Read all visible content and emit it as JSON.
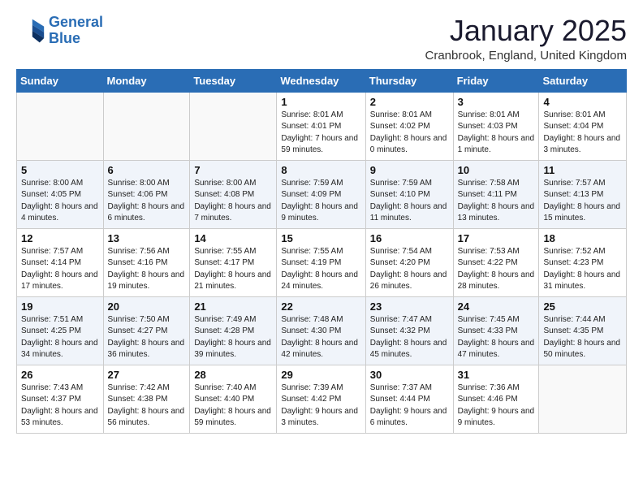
{
  "header": {
    "logo_line1": "General",
    "logo_line2": "Blue",
    "month_title": "January 2025",
    "location": "Cranbrook, England, United Kingdom"
  },
  "weekdays": [
    "Sunday",
    "Monday",
    "Tuesday",
    "Wednesday",
    "Thursday",
    "Friday",
    "Saturday"
  ],
  "weeks": [
    [
      {
        "day": "",
        "info": ""
      },
      {
        "day": "",
        "info": ""
      },
      {
        "day": "",
        "info": ""
      },
      {
        "day": "1",
        "info": "Sunrise: 8:01 AM\nSunset: 4:01 PM\nDaylight: 7 hours and 59 minutes."
      },
      {
        "day": "2",
        "info": "Sunrise: 8:01 AM\nSunset: 4:02 PM\nDaylight: 8 hours and 0 minutes."
      },
      {
        "day": "3",
        "info": "Sunrise: 8:01 AM\nSunset: 4:03 PM\nDaylight: 8 hours and 1 minute."
      },
      {
        "day": "4",
        "info": "Sunrise: 8:01 AM\nSunset: 4:04 PM\nDaylight: 8 hours and 3 minutes."
      }
    ],
    [
      {
        "day": "5",
        "info": "Sunrise: 8:00 AM\nSunset: 4:05 PM\nDaylight: 8 hours and 4 minutes."
      },
      {
        "day": "6",
        "info": "Sunrise: 8:00 AM\nSunset: 4:06 PM\nDaylight: 8 hours and 6 minutes."
      },
      {
        "day": "7",
        "info": "Sunrise: 8:00 AM\nSunset: 4:08 PM\nDaylight: 8 hours and 7 minutes."
      },
      {
        "day": "8",
        "info": "Sunrise: 7:59 AM\nSunset: 4:09 PM\nDaylight: 8 hours and 9 minutes."
      },
      {
        "day": "9",
        "info": "Sunrise: 7:59 AM\nSunset: 4:10 PM\nDaylight: 8 hours and 11 minutes."
      },
      {
        "day": "10",
        "info": "Sunrise: 7:58 AM\nSunset: 4:11 PM\nDaylight: 8 hours and 13 minutes."
      },
      {
        "day": "11",
        "info": "Sunrise: 7:57 AM\nSunset: 4:13 PM\nDaylight: 8 hours and 15 minutes."
      }
    ],
    [
      {
        "day": "12",
        "info": "Sunrise: 7:57 AM\nSunset: 4:14 PM\nDaylight: 8 hours and 17 minutes."
      },
      {
        "day": "13",
        "info": "Sunrise: 7:56 AM\nSunset: 4:16 PM\nDaylight: 8 hours and 19 minutes."
      },
      {
        "day": "14",
        "info": "Sunrise: 7:55 AM\nSunset: 4:17 PM\nDaylight: 8 hours and 21 minutes."
      },
      {
        "day": "15",
        "info": "Sunrise: 7:55 AM\nSunset: 4:19 PM\nDaylight: 8 hours and 24 minutes."
      },
      {
        "day": "16",
        "info": "Sunrise: 7:54 AM\nSunset: 4:20 PM\nDaylight: 8 hours and 26 minutes."
      },
      {
        "day": "17",
        "info": "Sunrise: 7:53 AM\nSunset: 4:22 PM\nDaylight: 8 hours and 28 minutes."
      },
      {
        "day": "18",
        "info": "Sunrise: 7:52 AM\nSunset: 4:23 PM\nDaylight: 8 hours and 31 minutes."
      }
    ],
    [
      {
        "day": "19",
        "info": "Sunrise: 7:51 AM\nSunset: 4:25 PM\nDaylight: 8 hours and 34 minutes."
      },
      {
        "day": "20",
        "info": "Sunrise: 7:50 AM\nSunset: 4:27 PM\nDaylight: 8 hours and 36 minutes."
      },
      {
        "day": "21",
        "info": "Sunrise: 7:49 AM\nSunset: 4:28 PM\nDaylight: 8 hours and 39 minutes."
      },
      {
        "day": "22",
        "info": "Sunrise: 7:48 AM\nSunset: 4:30 PM\nDaylight: 8 hours and 42 minutes."
      },
      {
        "day": "23",
        "info": "Sunrise: 7:47 AM\nSunset: 4:32 PM\nDaylight: 8 hours and 45 minutes."
      },
      {
        "day": "24",
        "info": "Sunrise: 7:45 AM\nSunset: 4:33 PM\nDaylight: 8 hours and 47 minutes."
      },
      {
        "day": "25",
        "info": "Sunrise: 7:44 AM\nSunset: 4:35 PM\nDaylight: 8 hours and 50 minutes."
      }
    ],
    [
      {
        "day": "26",
        "info": "Sunrise: 7:43 AM\nSunset: 4:37 PM\nDaylight: 8 hours and 53 minutes."
      },
      {
        "day": "27",
        "info": "Sunrise: 7:42 AM\nSunset: 4:38 PM\nDaylight: 8 hours and 56 minutes."
      },
      {
        "day": "28",
        "info": "Sunrise: 7:40 AM\nSunset: 4:40 PM\nDaylight: 8 hours and 59 minutes."
      },
      {
        "day": "29",
        "info": "Sunrise: 7:39 AM\nSunset: 4:42 PM\nDaylight: 9 hours and 3 minutes."
      },
      {
        "day": "30",
        "info": "Sunrise: 7:37 AM\nSunset: 4:44 PM\nDaylight: 9 hours and 6 minutes."
      },
      {
        "day": "31",
        "info": "Sunrise: 7:36 AM\nSunset: 4:46 PM\nDaylight: 9 hours and 9 minutes."
      },
      {
        "day": "",
        "info": ""
      }
    ]
  ]
}
